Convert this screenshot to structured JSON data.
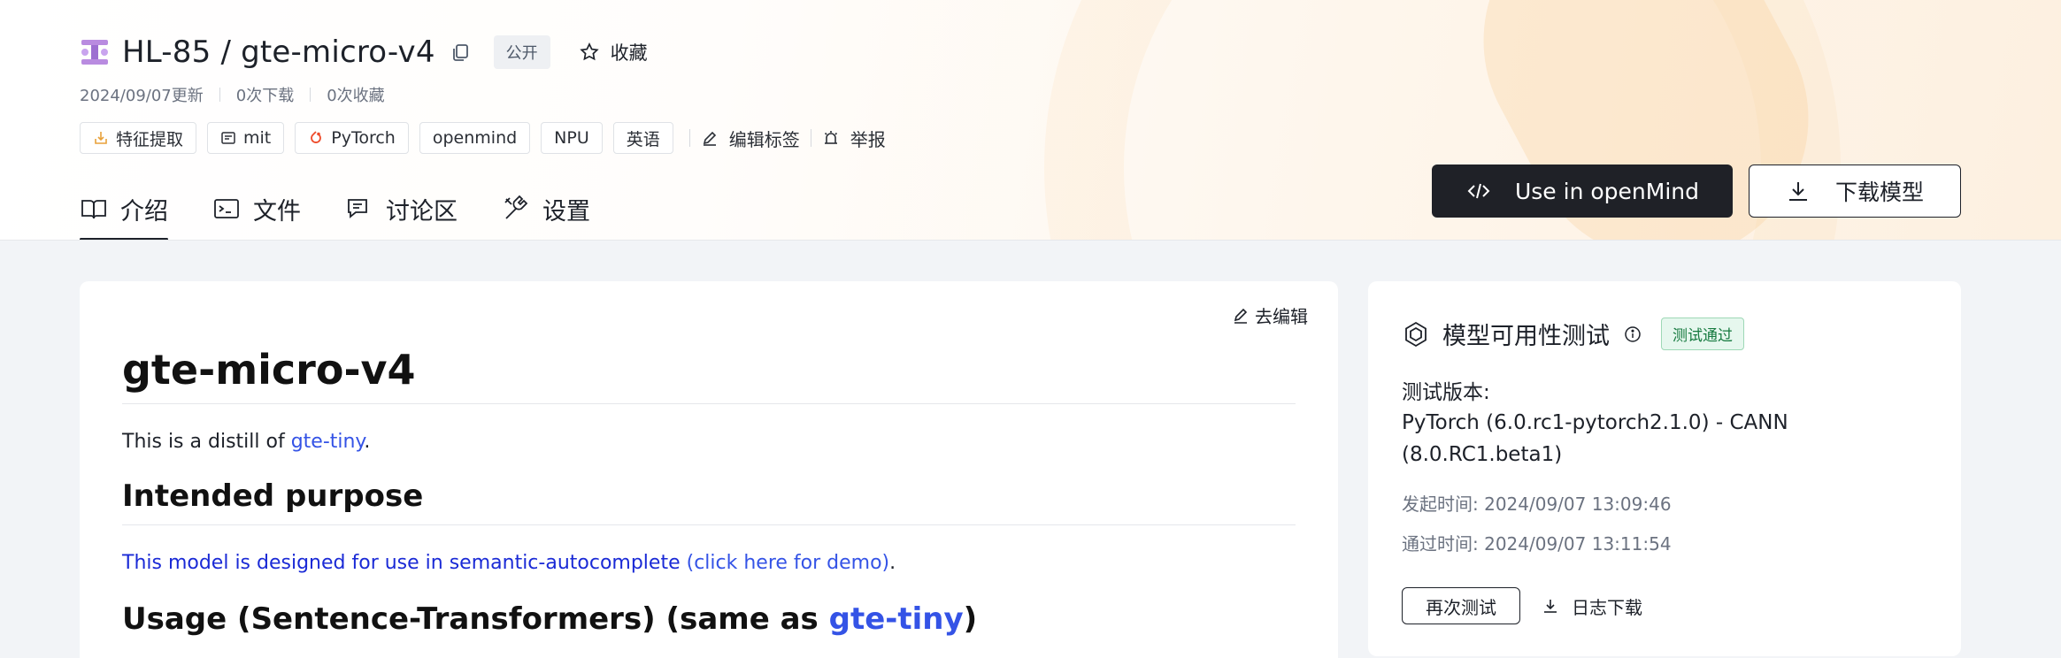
{
  "repo": {
    "owner": "HL-85",
    "name": "gte-micro-v4",
    "title": "HL-85 / gte-micro-v4",
    "visibility": "公开",
    "favorite_label": "收藏"
  },
  "meta": {
    "updated": "2024/09/07更新",
    "downloads": "0次下载",
    "favorites": "0次收藏"
  },
  "tags": [
    {
      "label": "特征提取",
      "icon": "feature-extract-icon"
    },
    {
      "label": "mit",
      "icon": "license-icon"
    },
    {
      "label": "PyTorch",
      "icon": "pytorch-icon"
    },
    {
      "label": "openmind",
      "icon": ""
    },
    {
      "label": "NPU",
      "icon": ""
    },
    {
      "label": "英语",
      "icon": ""
    }
  ],
  "tag_actions": {
    "edit_tags": "编辑标签",
    "report": "举报"
  },
  "tabs": [
    {
      "label": "介绍",
      "icon": "book-icon",
      "active": true
    },
    {
      "label": "文件",
      "icon": "folder-icon",
      "active": false
    },
    {
      "label": "讨论区",
      "icon": "chat-icon",
      "active": false
    },
    {
      "label": "设置",
      "icon": "tools-icon",
      "active": false
    }
  ],
  "actions": {
    "use_in_openmind": "Use in openMind",
    "download_model": "下载模型"
  },
  "readme": {
    "edit_label": "去编辑",
    "h1": "gte-micro-v4",
    "intro_prefix": "This is a distill of ",
    "intro_link": "gte-tiny",
    "intro_suffix": ".",
    "h2_purpose": "Intended purpose",
    "purpose_text": "This model is designed for use in semantic-autocomplete ",
    "purpose_link": "(click here for demo)",
    "purpose_suffix": ".",
    "h2_usage_prefix": "Usage (Sentence-Transformers) (same as ",
    "h2_usage_link": "gte-tiny",
    "h2_usage_suffix": ")"
  },
  "availability": {
    "title": "模型可用性测试",
    "status": "测试通过",
    "version_label": "测试版本:",
    "version_value": "PyTorch (6.0.rc1-pytorch2.1.0) - CANN (8.0.RC1.beta1)",
    "started": "发起时间: 2024/09/07 13:09:46",
    "passed": "通过时间: 2024/09/07 13:11:54",
    "retest_label": "再次测试",
    "log_download_label": "日志下载"
  },
  "colors": {
    "primary_dark": "#1f2127",
    "link": "#3453e6",
    "success_bg": "#e6f7ee",
    "success_text": "#167a3f",
    "page_bg": "#f2f4f7"
  }
}
